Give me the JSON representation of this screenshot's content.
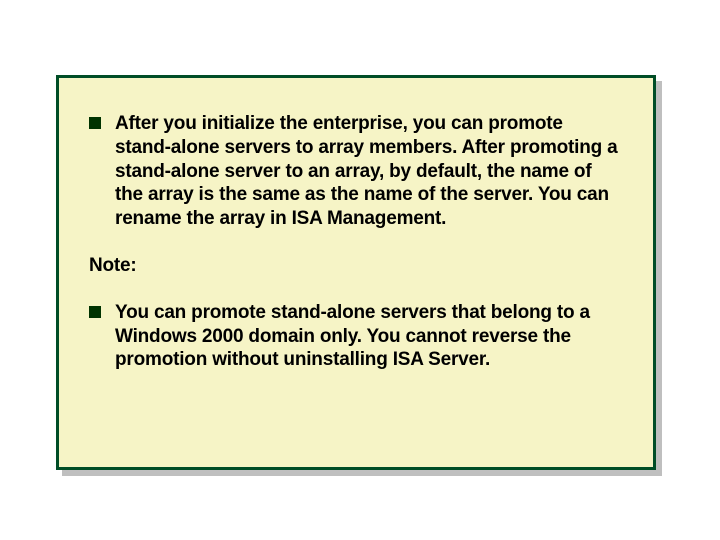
{
  "panel": {
    "bullet1": "After you initialize the enterprise, you can promote stand-alone servers to array members. After promoting a stand-alone server to an array, by default, the name of the array is the same as the name of the server. You can rename the array in ISA Management.",
    "note_label": "Note:",
    "bullet2": "You can promote stand-alone servers that belong to a Windows 2000 domain only. You cannot reverse the promotion without uninstalling ISA Server."
  }
}
